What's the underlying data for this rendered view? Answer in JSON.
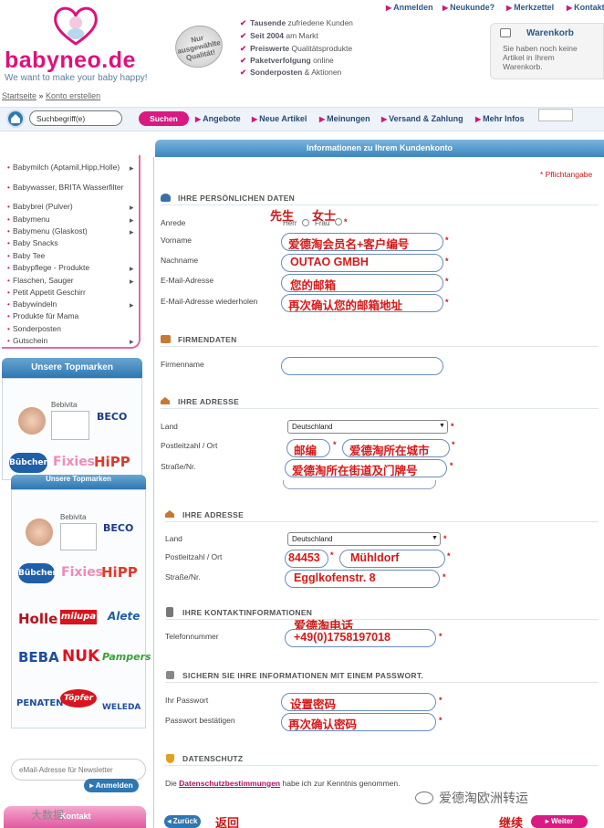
{
  "header": {
    "logo_text": "babyneo.de",
    "tagline": "We want to make your baby happy!",
    "seal_text": "Nur ausgewählte Qualität!",
    "usps": [
      {
        "bold": "Tausende",
        "rest": " zufriedene Kunden"
      },
      {
        "bold": "Seit 2004",
        "rest": " am Markt"
      },
      {
        "bold": "Preiswerte",
        "rest": " Qualitätsprodukte"
      },
      {
        "bold": "Paketverfolgung",
        "rest": " online"
      },
      {
        "bold": "Sonderposten",
        "rest": " & Aktionen"
      }
    ],
    "top_links": [
      "Anmelden",
      "Neukunde?",
      "Merkzettel",
      "Kontakt"
    ],
    "cart_title": "Warenkorb",
    "cart_text": "Sie haben noch keine Artikel in Ihrem Warenkorb."
  },
  "breadcrumb": {
    "home": "Startseite",
    "sep": " » ",
    "current": "Konto erstellen"
  },
  "nav": {
    "search_value": "Suchbegriff(e)",
    "search_button": "Suchen",
    "items": [
      "Angebote",
      "Neue Artikel",
      "Meinungen",
      "Versand & Zahlung",
      "Mehr Infos"
    ]
  },
  "sidebar": {
    "menu": [
      {
        "label": "Babymilch (Aptamil,Hipp,Holle)",
        "sub": true
      },
      {
        "label": "Babywasser, BRITA Wasserfilter",
        "sub": false
      },
      {
        "label": "Babybrei (Pulver)",
        "sub": true
      },
      {
        "label": "Babymenu",
        "sub": true
      },
      {
        "label": "Babymenu (Glaskost)",
        "sub": true
      },
      {
        "label": "Baby Snacks",
        "sub": false
      },
      {
        "label": "Baby Tee",
        "sub": false
      },
      {
        "label": "Babypflege - Produkte",
        "sub": true
      },
      {
        "label": "Flaschen, Sauger",
        "sub": true
      },
      {
        "label": "Petit Appetit Geschirr",
        "sub": false
      },
      {
        "label": "Babywindeln",
        "sub": true
      },
      {
        "label": "Produkte für Mama",
        "sub": false
      },
      {
        "label": "Sonderposten",
        "sub": false
      },
      {
        "label": "Gutschein",
        "sub": true
      }
    ],
    "topmarken_title": "Unsere Topmarken",
    "brands": {
      "bebivita": "Bebivita",
      "beco": "BECO",
      "bubchen": "Bübchen",
      "fixies": "Fixies",
      "hipp": "HiPP",
      "holle": "Holle",
      "milupa": "milupa",
      "alete": "Alete",
      "beba": "BEBA",
      "nuk": "NUK",
      "pampers": "Pampers",
      "penaten": "PENATEN",
      "topfer": "Töpfer",
      "weleda": "WELEDA"
    },
    "newsletter_placeholder": "eMail-Adresse für Newsletter",
    "newsletter_button": "Anmelden",
    "kontakt": "Kontakt"
  },
  "form": {
    "title": "Informationen zu Ihrem Kundenkonto",
    "required_note": "* Pflichtangabe",
    "sections": {
      "personal": "IHRE PERSÖNLICHEN DATEN",
      "company": "FIRMENDATEN",
      "address1": "IHRE ADRESSE",
      "address2": "IHRE ADRESSE",
      "contact": "IHRE KONTAKTINFORMATIONEN",
      "password": "SICHERN SIE IHRE INFORMATIONEN MIT EINEM PASSWORT.",
      "privacy": "DATENSCHUTZ"
    },
    "labels": {
      "anrede": "Anrede",
      "herr": "Herr",
      "frau": "Frau",
      "vorname": "Vorname",
      "nachname": "Nachname",
      "email": "E-Mail-Adresse",
      "email_repeat": "E-Mail-Adresse wiederholen",
      "firmenname": "Firmenname",
      "land": "Land",
      "plz_ort": "Postleitzahl / Ort",
      "strasse": "Straße/Nr.",
      "telefon": "Telefonnummer",
      "passwort": "Ihr Passwort",
      "passwort_confirm": "Passwort bestätigen"
    },
    "values": {
      "vorname": "爱德淘会员名+客户编号",
      "nachname": "OUTAO GMBH",
      "email": "您的邮箱",
      "email_repeat": "再次确认您的邮箱地址",
      "land1": "Deutschland",
      "plz1": "邮编",
      "ort1": "爱德淘所在城市",
      "strasse1": "爱德淘所在街道及门牌号",
      "land2": "Deutschland",
      "plz2": "84453",
      "ort2": "Mühldorf",
      "strasse2": "Egglkofenstr. 8",
      "telefon": "+49(0)1758197018",
      "passwort": "设置密码",
      "passwort_confirm": "再次确认密码"
    },
    "annotations": {
      "herr": "先生",
      "frau": "女士",
      "phone": "爱德淘电话",
      "back": "返回",
      "next": "继续"
    },
    "privacy": {
      "pre": "Die ",
      "link": "Datenschutzbestimmungen",
      "post": " habe ich zur Kenntnis genommen."
    },
    "back_button": "Zurück",
    "next_button": "Weiter",
    "star": "*"
  },
  "watermarks": {
    "wechat": "爱德淘欧洲转运",
    "bottom_left": "大数据"
  },
  "colors": {
    "brand_pink": "#d81a82",
    "brand_blue": "#2d77b2",
    "annotation_red": "#d81818"
  }
}
